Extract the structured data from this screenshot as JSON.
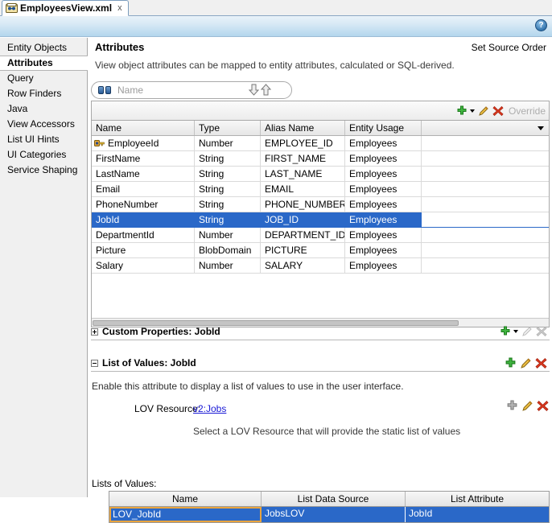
{
  "tab": {
    "label": "EmployeesView.xml",
    "close_label": "x",
    "icon": "xml-file-icon"
  },
  "toolbar": {
    "help_icon": "help-question-icon"
  },
  "sidebar": {
    "items": [
      {
        "label": "Entity Objects",
        "selected": false
      },
      {
        "label": "Attributes",
        "selected": true
      },
      {
        "label": "Query",
        "selected": false
      },
      {
        "label": "Row Finders",
        "selected": false
      },
      {
        "label": "Java",
        "selected": false
      },
      {
        "label": "View Accessors",
        "selected": false
      },
      {
        "label": "List UI Hints",
        "selected": false
      },
      {
        "label": "UI Categories",
        "selected": false
      },
      {
        "label": "Service Shaping",
        "selected": false
      }
    ]
  },
  "main": {
    "title": "Attributes",
    "set_source_order": "Set Source Order",
    "description": "View object attributes can be mapped to entity attributes, calculated or SQL-derived.",
    "filter": {
      "placeholder": "Name",
      "value": "",
      "icon": "binoculars-icon",
      "down_icon": "arrow-down-icon",
      "up_icon": "arrow-up-icon"
    },
    "grid_toolbar": {
      "add_icon": "green-plus-icon",
      "add_dropdown_icon": "caret-down-icon",
      "edit_icon": "pencil-icon",
      "delete_icon": "red-x-icon",
      "override_label": "Override"
    },
    "attributes_grid": {
      "columns": [
        "Name",
        "Type",
        "Alias Name",
        "Entity Usage",
        ""
      ],
      "rows": [
        {
          "name": "EmployeeId",
          "type": "Number",
          "alias": "EMPLOYEE_ID",
          "usage": "Employees",
          "key": true,
          "selected": false
        },
        {
          "name": "FirstName",
          "type": "String",
          "alias": "FIRST_NAME",
          "usage": "Employees",
          "key": false,
          "selected": false
        },
        {
          "name": "LastName",
          "type": "String",
          "alias": "LAST_NAME",
          "usage": "Employees",
          "key": false,
          "selected": false
        },
        {
          "name": "Email",
          "type": "String",
          "alias": "EMAIL",
          "usage": "Employees",
          "key": false,
          "selected": false
        },
        {
          "name": "PhoneNumber",
          "type": "String",
          "alias": "PHONE_NUMBER",
          "usage": "Employees",
          "key": false,
          "selected": false
        },
        {
          "name": "JobId",
          "type": "String",
          "alias": "JOB_ID",
          "usage": "Employees",
          "key": false,
          "selected": true
        },
        {
          "name": "DepartmentId",
          "type": "Number",
          "alias": "DEPARTMENT_ID",
          "usage": "Employees",
          "key": false,
          "selected": false
        },
        {
          "name": "Picture",
          "type": "BlobDomain",
          "alias": "PICTURE",
          "usage": "Employees",
          "key": false,
          "selected": false
        },
        {
          "name": "Salary",
          "type": "Number",
          "alias": "SALARY",
          "usage": "Employees",
          "key": false,
          "selected": false
        }
      ]
    },
    "custom_properties": {
      "title": "Custom Properties: JobId",
      "expanded": false,
      "expander_icon": "plus-box-icon",
      "add_icon": "green-plus-icon",
      "add_dropdown_icon": "caret-down-icon",
      "edit_icon": "pencil-icon-disabled",
      "delete_icon": "gray-x-icon-disabled"
    },
    "list_of_values": {
      "title": "List of Values: JobId",
      "expanded": true,
      "expander_icon": "minus-box-icon",
      "add_icon": "green-plus-icon",
      "edit_icon": "pencil-icon",
      "delete_icon": "red-x-icon",
      "description": "Enable this attribute to display a list of values to use in the user interface.",
      "lov_resource_label": "LOV Resource:",
      "lov_resource_value": "v2:Jobs",
      "lov_resource_hint": "Select a LOV Resource that will provide the static list of values",
      "resource_add_icon": "gray-plus-icon",
      "resource_edit_icon": "pencil-icon",
      "resource_delete_icon": "red-x-icon",
      "lists_label": "Lists of Values:",
      "lov_grid": {
        "columns": [
          "Name",
          "List Data Source",
          "List Attribute"
        ],
        "rows": [
          {
            "name": "LOV_JobId",
            "data_source": "JobsLOV",
            "attribute": "JobId",
            "selected": true,
            "focused_cell": 0
          }
        ]
      }
    }
  },
  "colors": {
    "selection_blue": "#2a68c8",
    "link_blue": "#1a1ad6",
    "focus_orange": "#e8a33d",
    "accent_green": "#2aa02a",
    "accent_red": "#d63c28"
  }
}
